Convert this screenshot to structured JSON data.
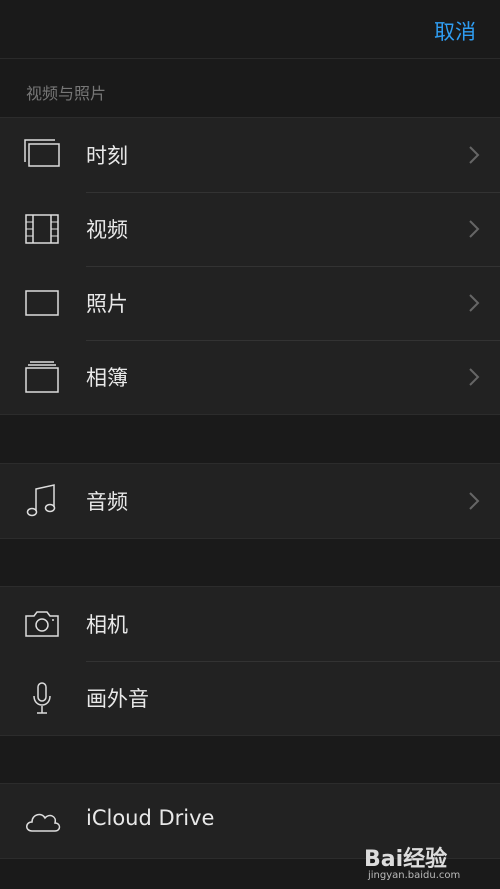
{
  "header": {
    "cancel_label": "取消"
  },
  "section_title": "视频与照片",
  "media_group": [
    {
      "label": "时刻",
      "icon": "moments-icon",
      "chevron": true
    },
    {
      "label": "视频",
      "icon": "film-icon",
      "chevron": true
    },
    {
      "label": "照片",
      "icon": "photo-icon",
      "chevron": true
    },
    {
      "label": "相簿",
      "icon": "albums-icon",
      "chevron": true
    }
  ],
  "audio_group": [
    {
      "label": "音频",
      "icon": "music-note-icon",
      "chevron": true
    }
  ],
  "capture_group": [
    {
      "label": "相机",
      "icon": "camera-icon",
      "chevron": false
    },
    {
      "label": "画外音",
      "icon": "microphone-icon",
      "chevron": false
    }
  ],
  "cloud_group": [
    {
      "label": "iCloud Drive",
      "icon": "cloud-icon",
      "chevron": false
    }
  ],
  "watermark": {
    "brand": "Bai经验",
    "url": "jingyan.baidu.com"
  },
  "colors": {
    "accent": "#2f9df2",
    "background": "#1a1a1a",
    "row": "#222222"
  }
}
